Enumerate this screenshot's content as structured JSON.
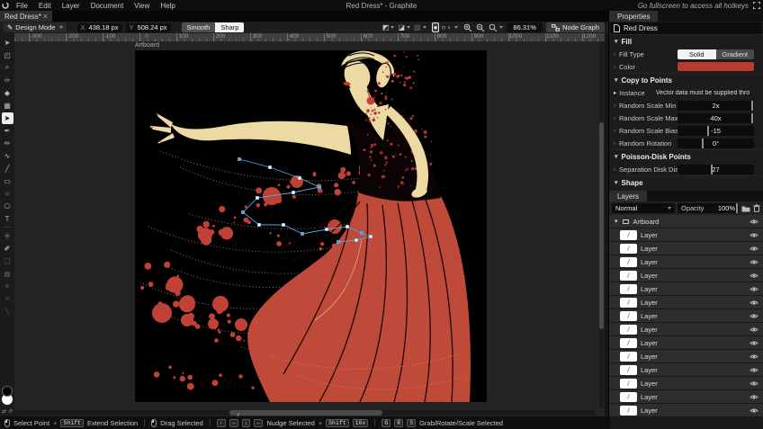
{
  "app": {
    "menu_items": [
      "File",
      "Edit",
      "Layer",
      "Document",
      "View",
      "Help"
    ],
    "window_title": "Red Dress* - Graphite",
    "fullscreen_hint": "Go fullscreen to access all hotkeys"
  },
  "tab_bar": {
    "active_tab": "Red Dress*",
    "close_glyph": "×"
  },
  "toolbar": {
    "mode_label": "Design Mode",
    "x_label": "X",
    "x_value": "438.18 px",
    "y_label": "Y",
    "y_value": "508.24 px",
    "smooth_label": "Smooth",
    "sharp_label": "Sharp",
    "zoom_value": "86.31%",
    "node_graph_label": "Node Graph"
  },
  "ruler_labels": [
    "-300",
    "-200",
    "-100",
    "0",
    "100",
    "200",
    "300",
    "400",
    "500",
    "600",
    "700",
    "800",
    "900",
    "1000",
    "1100",
    "1200"
  ],
  "canvas": {
    "artboard_label": "Artboard"
  },
  "tools": [
    {
      "name": "select-tool",
      "glyph": "➤",
      "state": "normal"
    },
    {
      "name": "artboard-tool",
      "glyph": "◰",
      "state": "normal"
    },
    {
      "name": "navigate-tool",
      "glyph": "⌕",
      "state": "normal"
    },
    {
      "name": "eyedropper-tool",
      "glyph": "✑",
      "state": "normal"
    },
    {
      "name": "fill-tool",
      "glyph": "◆",
      "state": "normal"
    },
    {
      "name": "gradient-tool",
      "glyph": "▦",
      "state": "normal"
    },
    {
      "name": "path-tool",
      "glyph": "➤",
      "state": "active"
    },
    {
      "name": "pen-tool",
      "glyph": "✒",
      "state": "normal"
    },
    {
      "name": "freehand-tool",
      "glyph": "✏",
      "state": "normal"
    },
    {
      "name": "spline-tool",
      "glyph": "∿",
      "state": "normal"
    },
    {
      "name": "line-tool",
      "glyph": "╱",
      "state": "normal"
    },
    {
      "name": "rectangle-tool",
      "glyph": "▭",
      "state": "normal"
    },
    {
      "name": "ellipse-tool",
      "glyph": "○",
      "state": "normal"
    },
    {
      "name": "polygon-tool",
      "glyph": "⎔",
      "state": "normal"
    },
    {
      "name": "text-tool",
      "glyph": "T",
      "state": "normal"
    },
    {
      "name": "tool-separator",
      "glyph": "",
      "state": "separator"
    },
    {
      "name": "heal-tool",
      "glyph": "✚",
      "state": "disabled"
    },
    {
      "name": "brush-tool",
      "glyph": "✐",
      "state": "bright"
    },
    {
      "name": "clone-tool",
      "glyph": "❏",
      "state": "disabled"
    },
    {
      "name": "patch-tool",
      "glyph": "▩",
      "state": "disabled"
    },
    {
      "name": "relight-tool",
      "glyph": "☀",
      "state": "disabled"
    },
    {
      "name": "slice-tool",
      "glyph": "⌗",
      "state": "disabled"
    },
    {
      "name": "knife-tool",
      "glyph": "╲",
      "state": "disabled"
    }
  ],
  "status_bar": {
    "groups": [
      [
        {
          "t": "micon",
          "v": "mouse-left"
        },
        {
          "t": "txt",
          "v": "Select Point"
        },
        {
          "t": "plus",
          "v": "+"
        },
        {
          "t": "key",
          "v": "Shift"
        },
        {
          "t": "txt",
          "v": "Extend Selection"
        }
      ],
      [
        {
          "t": "micon",
          "v": "mouse-drag"
        },
        {
          "t": "txt",
          "v": "Drag Selected"
        }
      ],
      [
        {
          "t": "key",
          "v": "↑"
        },
        {
          "t": "key",
          "v": "→"
        },
        {
          "t": "key",
          "v": "↓"
        },
        {
          "t": "key",
          "v": "←"
        },
        {
          "t": "txt",
          "v": "Nudge Selected"
        },
        {
          "t": "plus",
          "v": "+"
        },
        {
          "t": "key",
          "v": "Shift"
        },
        {
          "t": "key",
          "v": "10x"
        }
      ],
      [
        {
          "t": "key",
          "v": "G"
        },
        {
          "t": "key",
          "v": "R"
        },
        {
          "t": "key",
          "v": "S"
        },
        {
          "t": "txt",
          "v": "Grab/Rotate/Scale Selected"
        }
      ]
    ]
  },
  "properties": {
    "tab_label": "Properties",
    "document_name": "Red Dress",
    "fill_section": {
      "title": "Fill",
      "fill_type_label": "Fill Type",
      "solid_label": "Solid",
      "gradient_label": "Gradient",
      "color_label": "Color"
    },
    "copy_section": {
      "title": "Copy to Points",
      "instance_label": "Instance",
      "instance_value": "Vector data must be supplied thro",
      "params": [
        {
          "label": "Random Scale Min",
          "value": "2x",
          "slider": 98
        },
        {
          "label": "Random Scale Max",
          "value": "40x",
          "slider": 98
        },
        {
          "label": "Random Scale Bias",
          "value": "-15",
          "slider": 40
        },
        {
          "label": "Random Rotation",
          "value": "0°",
          "slider": 33
        }
      ]
    },
    "poisson_section": {
      "title": "Poisson-Disk Points",
      "params": [
        {
          "label": "Separation Disk Diamete",
          "value": "27",
          "slider": 45
        }
      ]
    },
    "shape_section": {
      "title": "Shape"
    }
  },
  "layers": {
    "tab_label": "Layers",
    "blend_mode": "Normal",
    "opacity_label": "Opacity",
    "opacity_value": "100%",
    "artboard_label": "Artboard",
    "items": [
      {
        "label": "Layer"
      },
      {
        "label": "Layer"
      },
      {
        "label": "Layer"
      },
      {
        "label": "Layer"
      },
      {
        "label": "Layer"
      },
      {
        "label": "Layer"
      },
      {
        "label": "Layer"
      },
      {
        "label": "Layer"
      },
      {
        "label": "Layer"
      },
      {
        "label": "Layer"
      },
      {
        "label": "Layer"
      },
      {
        "label": "Layer"
      },
      {
        "label": "Layer"
      },
      {
        "label": "Layer"
      }
    ]
  },
  "colors": {
    "accent_red": "#b93a2e",
    "dress_red": "#c04a3a",
    "circle_red": "#c14136",
    "cream": "#ecd9a4",
    "gold": "#c09858",
    "selection_blue": "#5aa3dd"
  }
}
